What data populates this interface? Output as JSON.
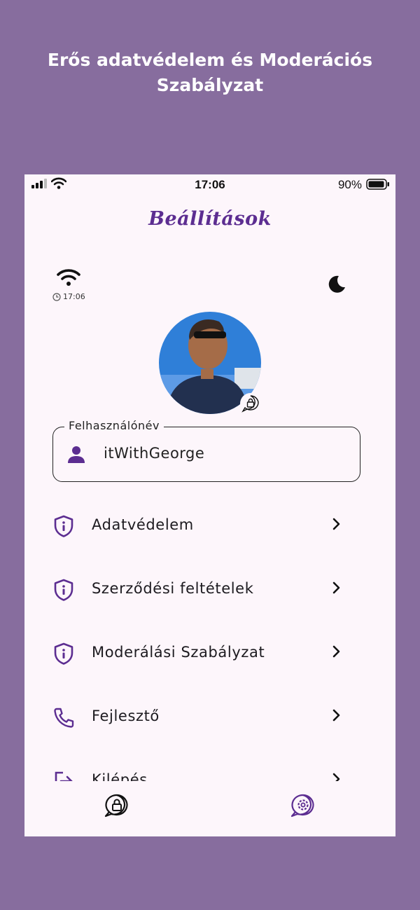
{
  "headline": "Erős adatvédelem és Moderációs Szabályzat",
  "status_bar": {
    "time": "17:06",
    "battery_pct": "90%",
    "icons": [
      "signal-icon",
      "wifi-icon",
      "battery-icon"
    ]
  },
  "app": {
    "title": "Beállítások",
    "network_time": "17:06",
    "icons": [
      "wifi-icon",
      "clock-icon",
      "moon-icon",
      "lock-icon"
    ]
  },
  "profile": {
    "field_label": "Felhasználónév",
    "username": "itWithGeorge",
    "icon": "person-icon"
  },
  "menu": [
    {
      "label": "Adatvédelem",
      "icon": "shield-info-icon"
    },
    {
      "label": "Szerződési feltételek",
      "icon": "shield-info-icon"
    },
    {
      "label": "Moderálási Szabályzat",
      "icon": "shield-info-icon"
    },
    {
      "label": "Fejlesztő",
      "icon": "phone-icon"
    },
    {
      "label": "Kilépés",
      "icon": "logout-icon"
    }
  ],
  "bottom_nav": {
    "items": [
      "lock-chat-icon",
      "settings-chat-icon"
    ]
  },
  "colors": {
    "background": "#876d9e",
    "accent": "#5c2d91",
    "surface": "#fdf6fb"
  }
}
